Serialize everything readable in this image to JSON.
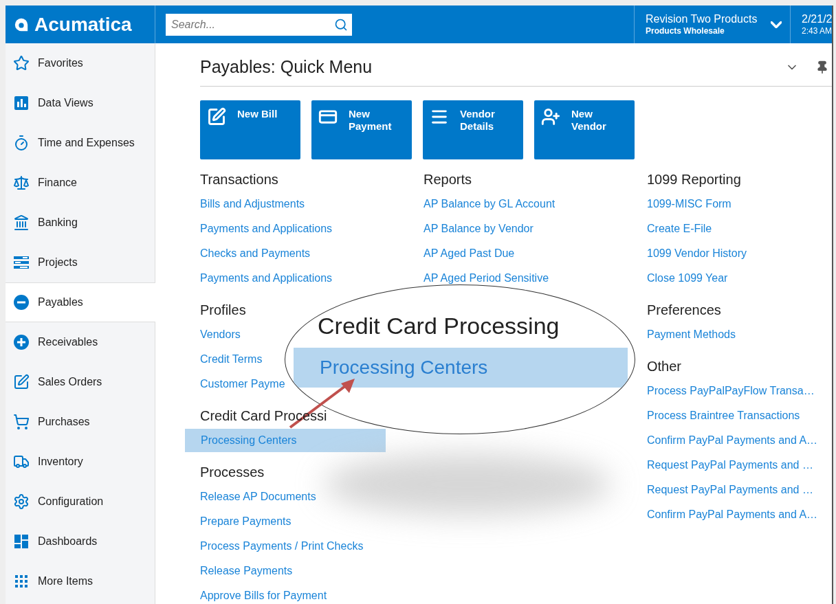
{
  "header": {
    "logo": "Acumatica",
    "search": {
      "placeholder": "Search..."
    },
    "company": {
      "name": "Revision Two Products",
      "branch": "Products Wholesale"
    },
    "datetime": {
      "date": "2/21/2",
      "time": "2:43 AM"
    }
  },
  "sidebar": {
    "items": [
      {
        "label": "Favorites",
        "selected": false
      },
      {
        "label": "Data Views",
        "selected": false
      },
      {
        "label": "Time and Expenses",
        "selected": false
      },
      {
        "label": "Finance",
        "selected": false
      },
      {
        "label": "Banking",
        "selected": false
      },
      {
        "label": "Projects",
        "selected": false
      },
      {
        "label": "Payables",
        "selected": true
      },
      {
        "label": "Receivables",
        "selected": false
      },
      {
        "label": "Sales Orders",
        "selected": false
      },
      {
        "label": "Purchases",
        "selected": false
      },
      {
        "label": "Inventory",
        "selected": false
      },
      {
        "label": "Configuration",
        "selected": false
      },
      {
        "label": "Dashboards",
        "selected": false
      },
      {
        "label": "More Items",
        "selected": false
      }
    ]
  },
  "page": {
    "title": "Payables: Quick Menu",
    "tiles": [
      {
        "label": "New Bill"
      },
      {
        "label": "New Payment"
      },
      {
        "label": "Vendor Details"
      },
      {
        "label": "New Vendor"
      }
    ],
    "columns": [
      [
        {
          "heading": "Transactions",
          "links": [
            {
              "label": "Bills and Adjustments",
              "selected": false
            },
            {
              "label": "Payments and Applications",
              "selected": false
            },
            {
              "label": "Checks and Payments",
              "selected": false
            },
            {
              "label": "Payments and Applications",
              "selected": false
            }
          ]
        },
        {
          "heading": "Profiles",
          "links": [
            {
              "label": "Vendors",
              "selected": false
            },
            {
              "label": "Credit Terms",
              "selected": false
            },
            {
              "label": "Customer Payme",
              "selected": false
            }
          ]
        },
        {
          "heading": "Credit Card Processi",
          "links": [
            {
              "label": "Processing Centers",
              "selected": true
            }
          ]
        },
        {
          "heading": "Processes",
          "links": [
            {
              "label": "Release AP Documents",
              "selected": false
            },
            {
              "label": "Prepare Payments",
              "selected": false
            },
            {
              "label": "Process Payments / Print Checks",
              "selected": false
            },
            {
              "label": "Release Payments",
              "selected": false
            },
            {
              "label": "Approve Bills for Payment",
              "selected": false
            }
          ]
        }
      ],
      [
        {
          "heading": "Reports",
          "links": [
            {
              "label": "AP Balance by GL Account",
              "selected": false
            },
            {
              "label": "AP Balance by Vendor",
              "selected": false
            },
            {
              "label": "AP Aged Past Due",
              "selected": false
            },
            {
              "label": "AP Aged Period Sensitive",
              "selected": false
            }
          ]
        }
      ],
      [
        {
          "heading": "1099 Reporting",
          "links": [
            {
              "label": "1099-MISC Form",
              "selected": false
            },
            {
              "label": "Create E-File",
              "selected": false
            },
            {
              "label": "1099 Vendor History",
              "selected": false
            },
            {
              "label": "Close 1099 Year",
              "selected": false
            }
          ]
        },
        {
          "heading": "Preferences",
          "links": [
            {
              "label": "Payment Methods",
              "selected": false
            }
          ]
        },
        {
          "heading": "Other",
          "links": [
            {
              "label": "Process PayPalPayFlow Transa…",
              "selected": false
            },
            {
              "label": "Process Braintree Transactions",
              "selected": false
            },
            {
              "label": "Confirm PayPal Payments and A…",
              "selected": false
            },
            {
              "label": "Request PayPal Payments and …",
              "selected": false
            },
            {
              "label": "Request PayPal Payments and …",
              "selected": false
            },
            {
              "label": "Confirm PayPal Payments and A…",
              "selected": false
            }
          ]
        }
      ]
    ]
  },
  "magnifier": {
    "heading": "Credit Card Processing",
    "link": {
      "label": "Processing Centers",
      "selected": true
    }
  }
}
